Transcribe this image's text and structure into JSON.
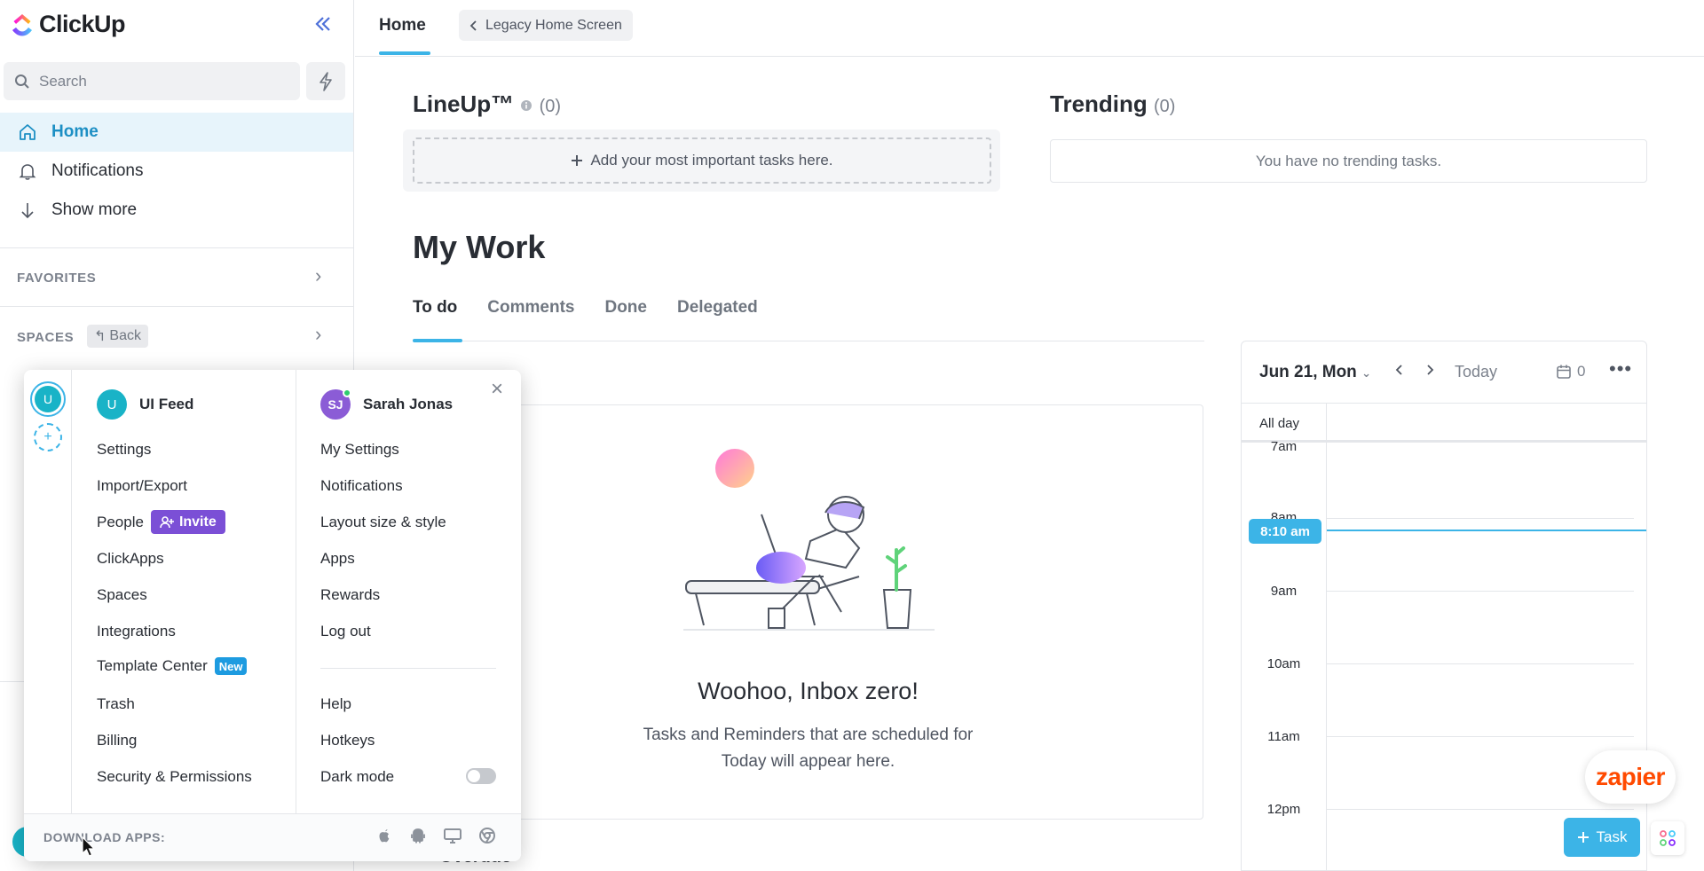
{
  "sidebar": {
    "logo_text": "ClickUp",
    "search_placeholder": "Search",
    "nav": [
      {
        "label": "Home",
        "icon": "home-icon",
        "active": true
      },
      {
        "label": "Notifications",
        "icon": "bell-icon"
      },
      {
        "label": "Show more",
        "icon": "arrow-down-icon"
      }
    ],
    "favorites_label": "FAVORITES",
    "spaces_label": "SPACES",
    "back_label": "Back"
  },
  "topbar": {
    "home_tab": "Home",
    "legacy_label": "Legacy Home Screen"
  },
  "lineup": {
    "title": "LineUp™",
    "count": "(0)",
    "add_label": "Add your most important tasks here."
  },
  "trending": {
    "title": "Trending",
    "count": "(0)",
    "empty": "You have no trending tasks."
  },
  "mywork": {
    "title": "My Work",
    "tabs": [
      "To do",
      "Comments",
      "Done",
      "Delegated"
    ],
    "empty_title": "Woohoo, Inbox zero!",
    "empty_sub_1": "Tasks and Reminders that are scheduled for",
    "empty_sub_2": "Today will appear here.",
    "next_section": "Overdue"
  },
  "calendar": {
    "date": "Jun 21, Mon",
    "today_label": "Today",
    "count": "0",
    "allday_label": "All day",
    "hours": [
      "7am",
      "8am",
      "9am",
      "10am",
      "11am",
      "12pm"
    ],
    "now_label": "8:10 am"
  },
  "floating": {
    "zapier": "zapier",
    "task_label": "Task"
  },
  "popup": {
    "workspace_initial": "U",
    "workspace_name": "UI Feed",
    "workspace_items": [
      "Settings",
      "Import/Export",
      "People",
      "ClickApps",
      "Spaces",
      "Integrations",
      "Template Center",
      "Trash",
      "Billing",
      "Security & Permissions"
    ],
    "invite_label": "Invite",
    "new_badge": "New",
    "user_initials": "SJ",
    "user_name": "Sarah Jonas",
    "user_items": [
      "My Settings",
      "Notifications",
      "Layout size & style",
      "Apps",
      "Rewards",
      "Log out"
    ],
    "user_items_2": [
      "Help",
      "Hotkeys",
      "Dark mode"
    ],
    "download_label": "DOWNLOAD APPS:"
  },
  "colors": {
    "accent": "#3cb4e7",
    "invite": "#7b4fd6",
    "zapier": "#ff4a00"
  }
}
